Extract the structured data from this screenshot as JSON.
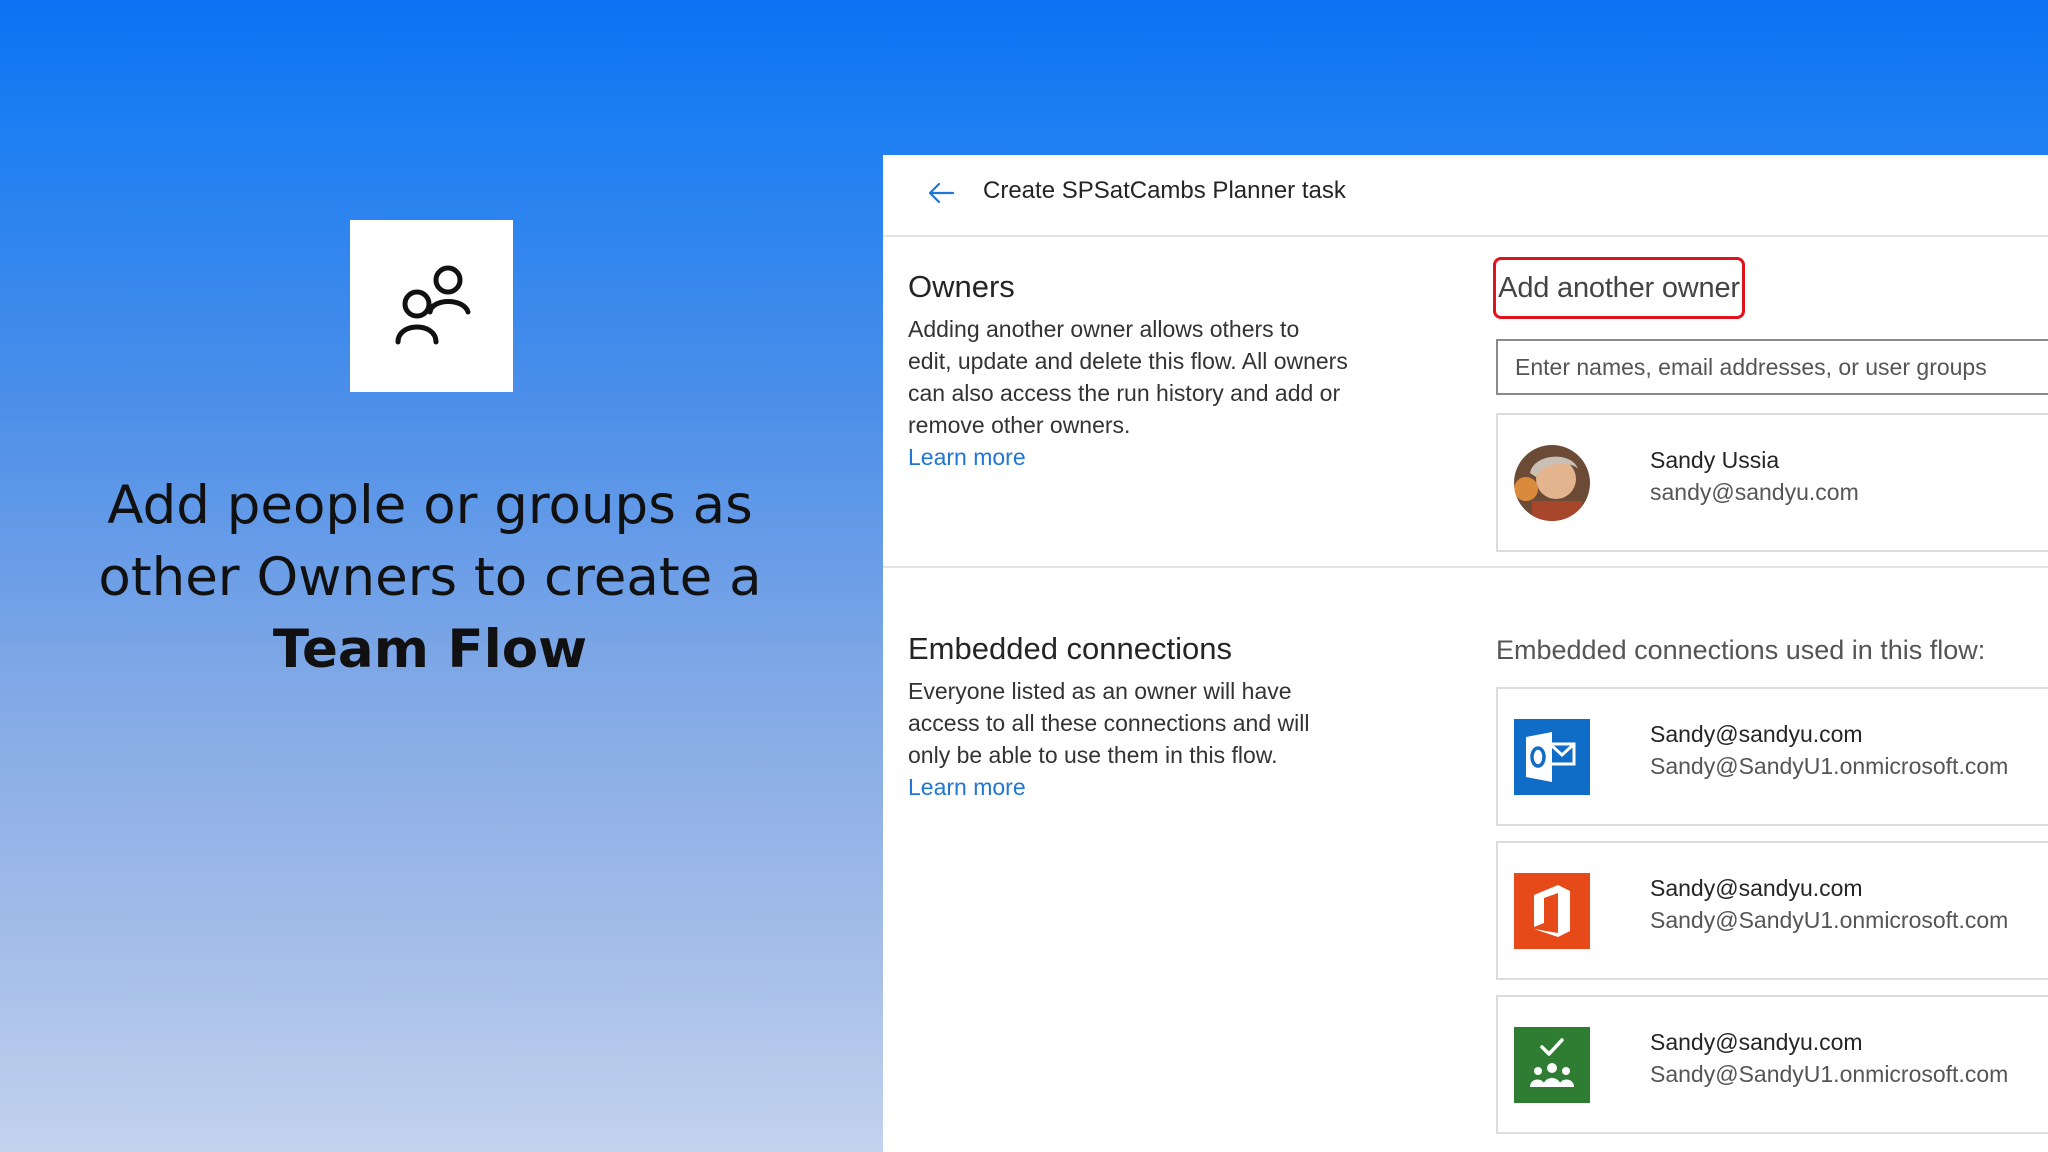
{
  "slide": {
    "caption_line1": "Add people or groups as",
    "caption_line2": "other Owners to create a",
    "caption_bold": "Team Flow"
  },
  "header": {
    "title": "Create SPSatCambs Planner task"
  },
  "owners": {
    "heading": "Owners",
    "description": "Adding another owner allows others to edit, update and delete this flow. All owners can also access the run history and add or remove other owners.",
    "learn_more": "Learn more",
    "add_owner_label": "Add another owner",
    "input_placeholder": "Enter names, email addresses, or user groups",
    "owner_list": [
      {
        "name": "Sandy Ussia",
        "email": "sandy@sandyu.com",
        "icon": "user-avatar"
      }
    ]
  },
  "embedded": {
    "heading": "Embedded connections",
    "description": "Everyone listed as an owner will have access to all these connections and will only be able to use them in this flow.",
    "learn_more": "Learn more",
    "list_label": "Embedded connections used in this flow:",
    "connections": [
      {
        "account": "Sandy@sandyu.com",
        "tenant": "Sandy@SandyU1.onmicrosoft.com",
        "icon": "outlook-icon",
        "color": "#0f6cc7"
      },
      {
        "account": "Sandy@sandyu.com",
        "tenant": "Sandy@SandyU1.onmicrosoft.com",
        "icon": "office-icon",
        "color": "#e64a19"
      },
      {
        "account": "Sandy@sandyu.com",
        "tenant": "Sandy@SandyU1.onmicrosoft.com",
        "icon": "planner-icon",
        "color": "#2e7d32"
      }
    ]
  },
  "colors": {
    "highlight": "#e0121b",
    "link": "#2176d4",
    "background_top": "#0a72f3",
    "background_bottom": "#c3d3ee"
  }
}
